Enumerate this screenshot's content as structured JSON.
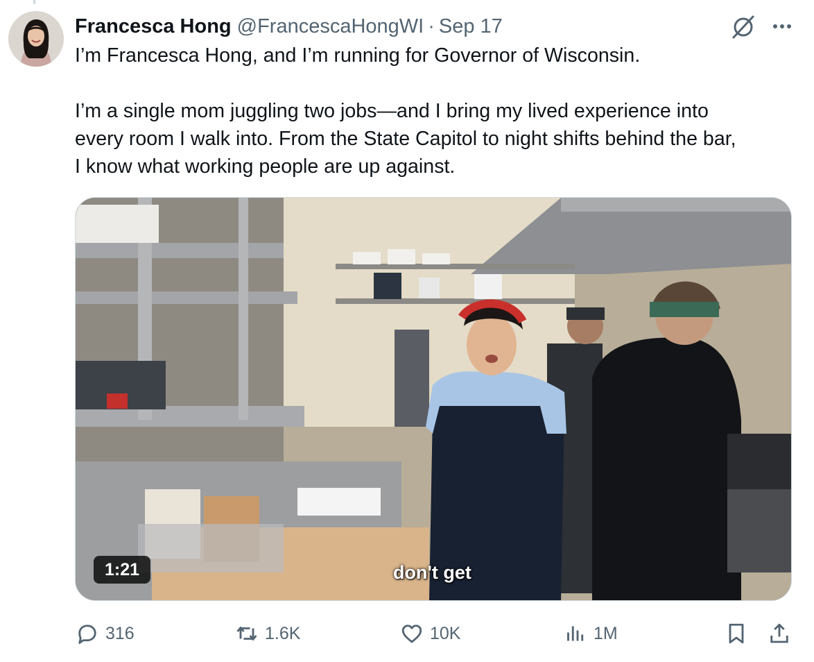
{
  "author": {
    "name": "Francesca Hong",
    "handle": "@FrancescaHongWI",
    "separator": "·",
    "date": "Sep 17"
  },
  "tweet": {
    "paragraph1": "I’m Francesca Hong, and I’m running for Governor of Wisconsin.",
    "paragraph2_line1": "I’m a single mom juggling two jobs—and I bring my lived experience into",
    "paragraph2_line2": "every room I walk into. From the State Capitol to night shifts behind the bar,",
    "paragraph2_line3": "I know what working people are up against."
  },
  "video": {
    "duration": "1:21",
    "caption": "don't get"
  },
  "actions": {
    "replies": "316",
    "reposts": "1.6K",
    "likes": "10K",
    "views": "1M"
  },
  "icons": {
    "reply": "reply-icon",
    "repost": "repost-icon",
    "like": "heart-icon",
    "views": "views-icon",
    "bookmark": "bookmark-icon",
    "share": "share-icon",
    "grok": "grok-icon",
    "more": "more-icon"
  },
  "colors": {
    "text": "#0f1419",
    "secondary": "#536471",
    "border": "#cfd9de"
  }
}
